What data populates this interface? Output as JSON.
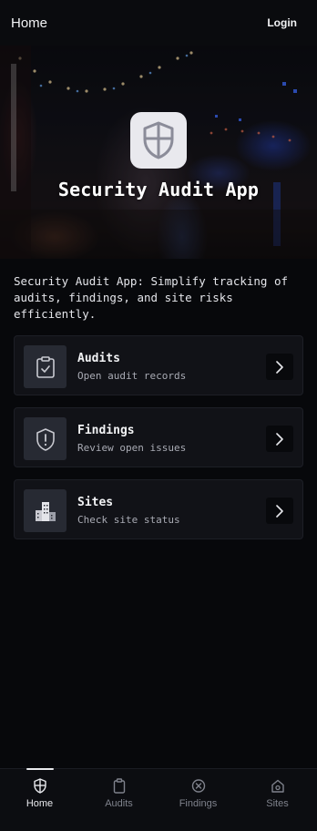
{
  "header": {
    "title": "Home",
    "login_label": "Login"
  },
  "hero": {
    "title": "Security Audit App",
    "icon": "shield-icon"
  },
  "intro": "Security Audit App: Simplify tracking of audits, findings, and site risks efficiently.",
  "cards": [
    {
      "title": "Audits",
      "subtitle": "Open audit records",
      "icon": "clipboard-check-icon"
    },
    {
      "title": "Findings",
      "subtitle": "Review open issues",
      "icon": "shield-alert-icon"
    },
    {
      "title": "Sites",
      "subtitle": "Check site status",
      "icon": "building-icon"
    }
  ],
  "nav": [
    {
      "label": "Home",
      "icon": "shield-icon",
      "active": true
    },
    {
      "label": "Audits",
      "icon": "clipboard-icon",
      "active": false
    },
    {
      "label": "Findings",
      "icon": "x-circle-icon",
      "active": false
    },
    {
      "label": "Sites",
      "icon": "house-icon",
      "active": false
    }
  ],
  "colors": {
    "background": "#07080b",
    "card": "#111217",
    "thumb": "#272a33",
    "active_nav": "#e8e9ed",
    "inactive_nav": "#7f828c"
  }
}
